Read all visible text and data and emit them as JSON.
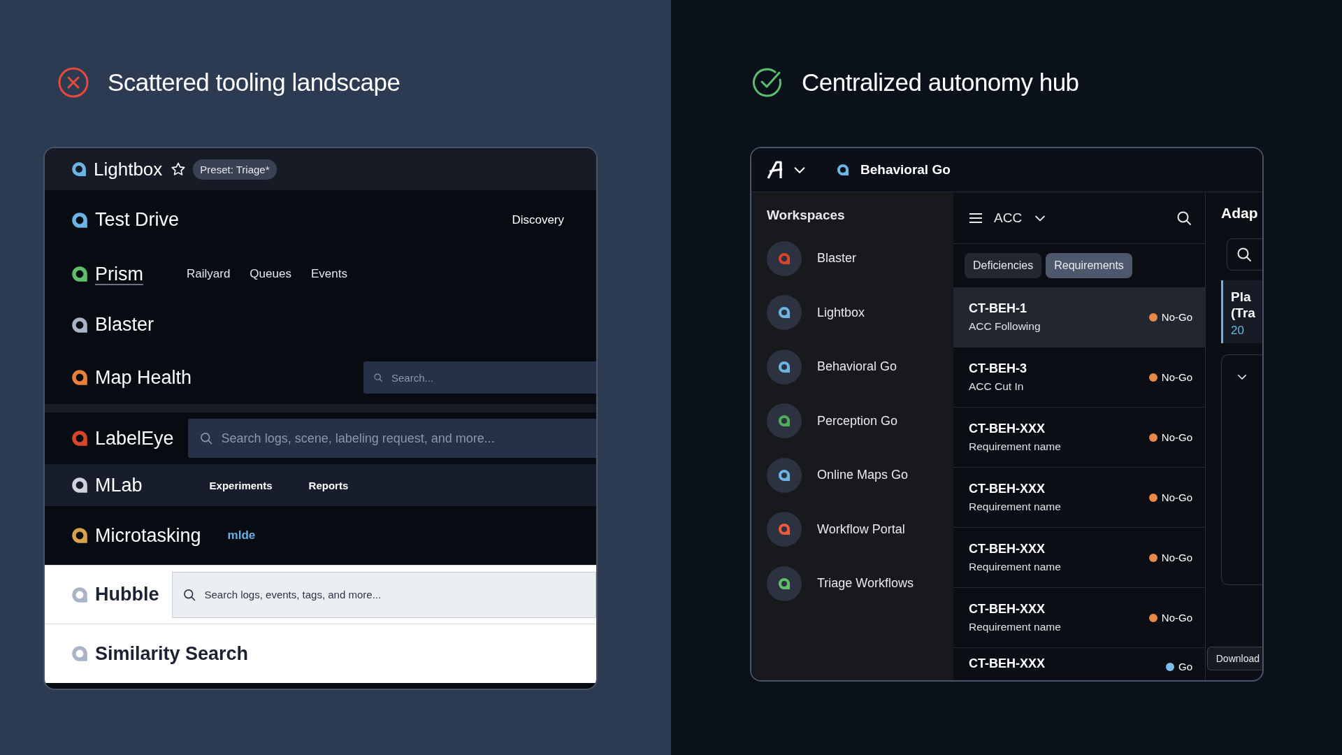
{
  "before": {
    "heading": {
      "text": "Scattered tooling landscape",
      "kind": "bad"
    },
    "apps": [
      {
        "name": "Lightbox",
        "color": "#6cb4e4",
        "kind": "header",
        "underlined": false,
        "badge": "Preset: Triage*"
      },
      {
        "name": "Test Drive",
        "color": "#6cb4e4",
        "kind": "dark",
        "underlined": false,
        "nav": {
          "kind": "right",
          "items": [
            "Discovery"
          ]
        }
      },
      {
        "name": "Prism",
        "color": "#5fbf6a",
        "kind": "dark",
        "underlined": true,
        "nav": {
          "kind": "inline",
          "items": [
            "Railyard",
            "Queues",
            "Events"
          ]
        }
      },
      {
        "name": "Blaster",
        "color": "#aab4c8",
        "kind": "dark",
        "underlined": false
      },
      {
        "name": "Map Health",
        "color": "#e8803a",
        "kind": "dark",
        "underlined": false,
        "search": {
          "placeholder": "Search...",
          "kind": "compact"
        }
      },
      {
        "name": "LabelEye",
        "color": "#d9442c",
        "kind": "dark",
        "underlined": false,
        "search": {
          "placeholder": "Search logs, scene, labeling request, and more...",
          "kind": "wide"
        }
      },
      {
        "name": "MLab",
        "color": "#cfd2d8",
        "kind": "band",
        "underlined": false,
        "nav": {
          "kind": "bold",
          "items": [
            "Experiments",
            "Reports"
          ]
        }
      },
      {
        "name": "Microtasking",
        "color": "#d9a24a",
        "kind": "dark",
        "underlined": false,
        "link": "mlde"
      },
      {
        "name": "Hubble",
        "color": "#aab4c8",
        "kind": "light",
        "underlined": false,
        "search": {
          "placeholder": "Search logs, events, tags, and more...",
          "kind": "boxed"
        }
      },
      {
        "name": "Similarity Search",
        "color": "#aab4c8",
        "kind": "light",
        "underlined": false
      }
    ]
  },
  "after": {
    "heading": {
      "text": "Centralized autonomy hub",
      "kind": "good"
    },
    "header": {
      "workspace": "Behavioral Go",
      "color": "#6cb4e4"
    },
    "sidebar": {
      "title": "Workspaces",
      "items": [
        {
          "name": "Blaster",
          "color": "#d9442c"
        },
        {
          "name": "Lightbox",
          "color": "#6cb4e4"
        },
        {
          "name": "Behavioral Go",
          "color": "#6cb4e4"
        },
        {
          "name": "Perception Go",
          "color": "#4fae5a"
        },
        {
          "name": "Online Maps Go",
          "color": "#6cb4e4"
        },
        {
          "name": "Workflow Portal",
          "color": "#f05a3a"
        },
        {
          "name": "Triage Workflows",
          "color": "#5fbf6a"
        }
      ]
    },
    "list": {
      "filter": "ACC",
      "tabs": [
        {
          "label": "Deficiencies",
          "selected": false
        },
        {
          "label": "Requirements",
          "selected": true
        }
      ],
      "rows": [
        {
          "id": "CT-BEH-1",
          "name": "ACC Following",
          "status": "No-Go",
          "color": "#e8894a",
          "selected": true
        },
        {
          "id": "CT-BEH-3",
          "name": "ACC Cut In",
          "status": "No-Go",
          "color": "#e8894a",
          "selected": false
        },
        {
          "id": "CT-BEH-XXX",
          "name": "Requirement name",
          "status": "No-Go",
          "color": "#e8894a",
          "selected": false
        },
        {
          "id": "CT-BEH-XXX",
          "name": "Requirement name",
          "status": "No-Go",
          "color": "#e8894a",
          "selected": false
        },
        {
          "id": "CT-BEH-XXX",
          "name": "Requirement name",
          "status": "No-Go",
          "color": "#e8894a",
          "selected": false
        },
        {
          "id": "CT-BEH-XXX",
          "name": "Requirement name",
          "status": "No-Go",
          "color": "#e8894a",
          "selected": false
        },
        {
          "id": "CT-BEH-XXX",
          "status": "Go",
          "color": "#7cc0ea",
          "selected": false
        }
      ]
    },
    "detail": {
      "title": "Adap",
      "card": [
        "Pla",
        "(Tra"
      ],
      "card_count": "20",
      "tooltip": "Download"
    }
  }
}
